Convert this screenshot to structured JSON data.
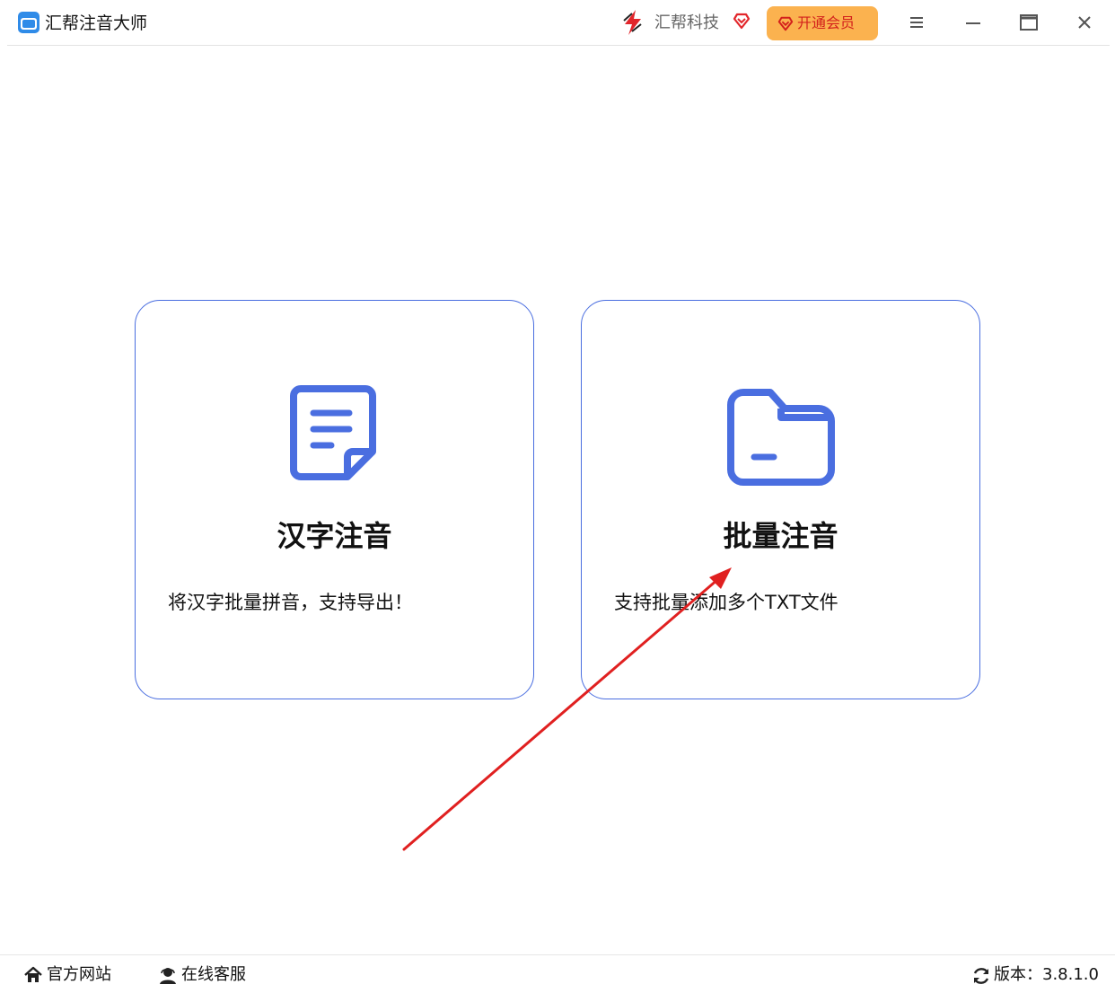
{
  "app": {
    "title": "汇帮注音大师",
    "logo_icon": "app-logo-icon"
  },
  "header": {
    "brand_name": "汇帮科技",
    "vip_label": "开通会员",
    "icons": [
      "brand-logo-icon",
      "diamond-icon",
      "menu-icon",
      "minimize-icon",
      "maximize-icon",
      "close-icon"
    ]
  },
  "cards": [
    {
      "title": "汉字注音",
      "description": "将汉字批量拼音，支持导出！",
      "icon": "document-icon"
    },
    {
      "title": "批量注音",
      "description": "支持批量添加多个TXT文件",
      "icon": "folder-icon"
    }
  ],
  "footer": {
    "website_label": "官方网站",
    "support_label": "在线客服",
    "version_label": "版本：3.8.1.0"
  },
  "colors": {
    "accent_blue": "#4a6ee0",
    "vip_orange": "#fbb24f",
    "vip_text": "#d3201c",
    "arrow_red": "#e02020"
  }
}
